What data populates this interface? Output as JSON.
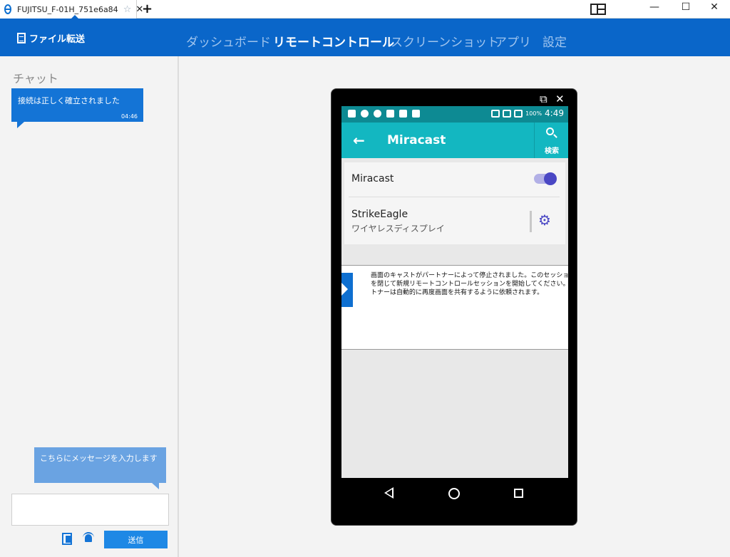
{
  "window": {
    "tab_title": "FUJITSU_F-01H_751e6a84",
    "new_tab": "+",
    "minimize": "—",
    "maximize": "☐",
    "close": "✕"
  },
  "nav": {
    "file_transfer": "ファイル転送",
    "items": [
      {
        "label": "ダッシュボード",
        "active": false
      },
      {
        "label": "リモートコントロール",
        "active": true
      },
      {
        "label": "スクリーンショット",
        "active": false
      },
      {
        "label": "アプリ",
        "active": false
      },
      {
        "label": "設定",
        "active": false
      }
    ]
  },
  "chat": {
    "title": "チャット",
    "messages": [
      {
        "text": "接続は正しく確立されました",
        "time": "04:46"
      }
    ],
    "hint": "こちらにメッセージを入力します",
    "input_value": "",
    "send_label": "送信"
  },
  "phone": {
    "status": {
      "battery": "100%",
      "time": "4:49"
    },
    "app_title": "Miracast",
    "search_label": "検索",
    "miracast_label": "Miracast",
    "miracast_enabled": true,
    "device_name": "StrikeEagle",
    "device_type": "ワイヤレスディスプレイ",
    "overlay_lines": [
      "画面のキャストがパートナーによって停止されました。このセッションウ",
      "を閉じて新規リモートコントロールセッションを開始してください。あなた",
      "トナーは自動的に再度画面を共有するように依頼されます。"
    ]
  },
  "colors": {
    "nav_blue": "#0a66c9",
    "chat_bubble": "#1474d6",
    "android_status": "#0d8a93",
    "android_appbar": "#13b7c1",
    "toggle_accent": "#4a47c4"
  },
  "icons": [
    "teamviewer-icon",
    "star-icon",
    "close-icon",
    "layout-icon",
    "document-icon",
    "search-icon",
    "gear-icon",
    "attach-icon",
    "alarm-icon",
    "back-icon",
    "home-icon",
    "recents-icon",
    "popout-icon"
  ]
}
